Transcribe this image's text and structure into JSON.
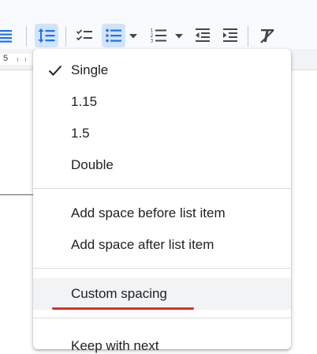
{
  "toolbar": {
    "buttons": [
      {
        "name": "align-justify",
        "icon": "align-justify-icon"
      },
      {
        "name": "line-spacing",
        "icon": "line-spacing-icon",
        "active": true
      },
      {
        "name": "checklist",
        "icon": "checklist-icon"
      },
      {
        "name": "bulleted-list",
        "icon": "bulleted-list-icon",
        "active": true
      },
      {
        "name": "numbered-list",
        "icon": "numbered-list-icon"
      },
      {
        "name": "decrease-indent",
        "icon": "decrease-indent-icon"
      },
      {
        "name": "increase-indent",
        "icon": "increase-indent-icon"
      },
      {
        "name": "clear-formatting",
        "icon": "clear-formatting-icon"
      }
    ],
    "accent_color": "#1a73e8",
    "icon_color": "#444746",
    "active_bg": "#d3e3fd"
  },
  "ruler": {
    "visible_number": "5"
  },
  "menu": {
    "spacing_options": [
      {
        "label": "Single",
        "checked": true
      },
      {
        "label": "1.15",
        "checked": false
      },
      {
        "label": "1.5",
        "checked": false
      },
      {
        "label": "Double",
        "checked": false
      }
    ],
    "list_options": [
      {
        "label": "Add space before list item"
      },
      {
        "label": "Add space after list item"
      }
    ],
    "custom_spacing_label": "Custom spacing",
    "partial_item_label": "Keep with next",
    "annotation_color": "#d93025"
  }
}
